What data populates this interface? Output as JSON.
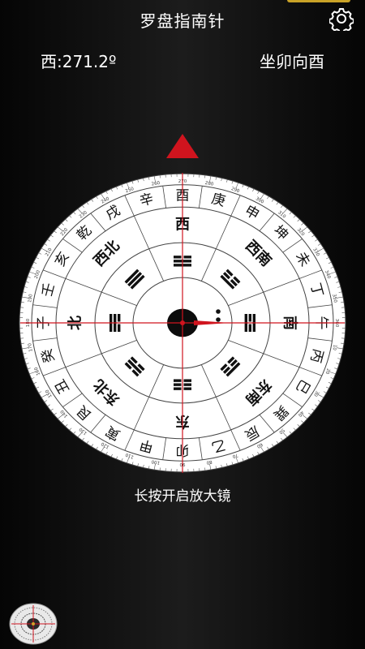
{
  "app": {
    "title": "罗盘指南针"
  },
  "readout": {
    "heading": "西:271.2º",
    "sitting": "坐卯向酉"
  },
  "hint": {
    "magnifier": "长按开启放大镜"
  },
  "colors": {
    "accent": "#c9a227",
    "pointer": "#d0141e",
    "dial": "#ffffff",
    "ink": "#111111"
  },
  "icons": {
    "settings": "gear-icon",
    "pointer": "triangle-pointer-icon",
    "thumbnail": "compass-thumbnail-icon"
  },
  "compass": {
    "rotation_deg": 271.2,
    "outer_ring_chars": [
      "酉",
      "庚",
      "申",
      "坤",
      "未",
      "丁",
      "午",
      "丙",
      "巳",
      "巽",
      "辰",
      "乙",
      "卯",
      "甲",
      "寅",
      "艮",
      "丑",
      "癸",
      "子",
      "壬",
      "亥",
      "乾",
      "戌",
      "辛"
    ],
    "middle_ring_chars": [
      "西",
      "西南",
      "南",
      "东南",
      "东",
      "东北",
      "北",
      "西北"
    ],
    "degree_labels": [
      "270",
      "280",
      "290",
      "300",
      "310",
      "320",
      "330",
      "340",
      "350",
      "360",
      "10",
      "20",
      "30",
      "40",
      "50",
      "60",
      "70",
      "80",
      "90",
      "100",
      "110",
      "120",
      "130",
      "140",
      "150",
      "160",
      "170",
      "180",
      "190",
      "200",
      "210",
      "220",
      "230",
      "240",
      "250",
      "260"
    ]
  }
}
